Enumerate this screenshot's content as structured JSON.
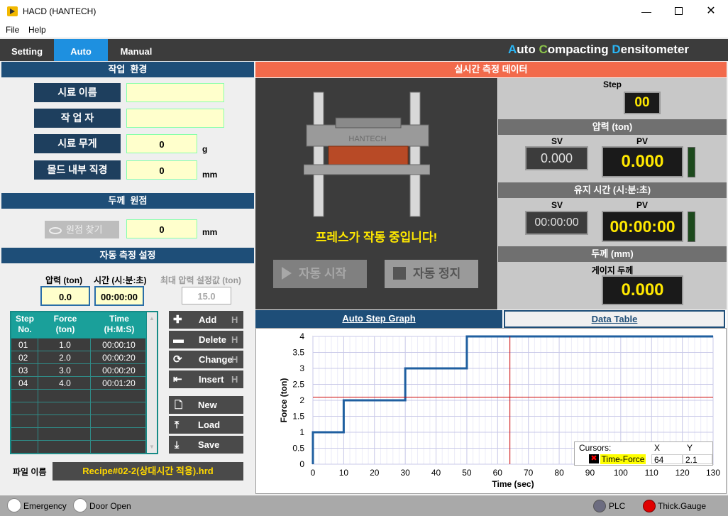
{
  "window": {
    "title": "HACD (HANTECH)"
  },
  "menu": [
    "File",
    "Help"
  ],
  "tabs": [
    "Setting",
    "Auto",
    "Manual"
  ],
  "brand": {
    "p1": "A",
    "p2": "uto ",
    "p3": "C",
    "p4": "ompacting ",
    "p5": "D",
    "p6": "ensitometer"
  },
  "env": {
    "header": "작업  환경",
    "sample_name_label": "시료 이름",
    "sample_name": "",
    "worker_label": "작 업 자",
    "worker": "",
    "weight_label": "시료 무게",
    "weight": "0",
    "weight_unit": "g",
    "diam_label": "몰드 내부 직경",
    "diam": "0",
    "diam_unit": "mm"
  },
  "origin": {
    "header": "두께  원점",
    "find_label": "원점 찾기",
    "value": "0",
    "unit": "mm"
  },
  "auto": {
    "header": "자동 측정 설정",
    "press_label": "압력 (ton)",
    "press": "0.0",
    "time_label": "시간 (시:분:초)",
    "time": "00:00:00",
    "max_label": "최대 압력 설정값 (ton)",
    "max": "15.0"
  },
  "table": {
    "headers": [
      [
        "Step",
        "No."
      ],
      [
        "Force",
        "(ton)"
      ],
      [
        "Time",
        "(H:M:S)"
      ]
    ],
    "rows": [
      [
        "01",
        "1.0",
        "00:00:10"
      ],
      [
        "02",
        "2.0",
        "00:00:20"
      ],
      [
        "03",
        "3.0",
        "00:00:20"
      ],
      [
        "04",
        "4.0",
        "00:01:20"
      ]
    ]
  },
  "side_buttons": [
    "Add",
    "Delete",
    "Change",
    "Insert"
  ],
  "side_hotkey": "H",
  "file_buttons": [
    "New",
    "Load",
    "Save"
  ],
  "file": {
    "label": "파일 이름",
    "name": "Recipe#02-2(상대시간 적용).hrd"
  },
  "realtime": {
    "header": "실시간 측정 데이터",
    "press_logo": "HANTECH",
    "status": "프레스가 작동 중입니다!",
    "start": "자동 시작",
    "stop": "자동 정지"
  },
  "meas": {
    "step_label": "Step",
    "step": "00",
    "pressure_header": "압력 (ton)",
    "sv": "SV",
    "pv": "PV",
    "pressure_sv": "0.000",
    "pressure_pv": "0.000",
    "hold_header": "유지 시간 (시:분:초)",
    "hold_sv": "00:00:00",
    "hold_pv": "00:00:00",
    "thick_header": "두께 (mm)",
    "gauge_label": "게이지 두께",
    "gauge": "0.000"
  },
  "graph_tabs": [
    "Auto Step Graph",
    "Data Table"
  ],
  "chart_data": {
    "type": "line",
    "xlabel": "Time (sec)",
    "ylabel": "Force (ton)",
    "xlim": [
      0,
      130
    ],
    "ylim": [
      0,
      4
    ],
    "xticks": [
      0,
      10,
      20,
      30,
      40,
      50,
      60,
      70,
      80,
      90,
      100,
      110,
      120,
      130
    ],
    "yticks": [
      "0",
      "0.5",
      "1",
      "1.5",
      "2",
      "2.5",
      "3",
      "3.5",
      "4"
    ],
    "x": [
      0,
      0,
      10,
      10,
      30,
      30,
      50,
      50,
      130
    ],
    "y": [
      0,
      1,
      1,
      2,
      2,
      3,
      3,
      4,
      4
    ],
    "cursor": {
      "x": 64,
      "y": 2.1
    },
    "line_color": "#1f5fa0",
    "grid": true
  },
  "cursors": {
    "title": "Cursors:",
    "x_head": "X",
    "y_head": "Y",
    "name": "Time-Force",
    "x": "64",
    "y": "2.1"
  },
  "status": {
    "emergency": "Emergency",
    "door": "Door Open",
    "plc": "PLC",
    "thick": "Thick.Gauge"
  }
}
